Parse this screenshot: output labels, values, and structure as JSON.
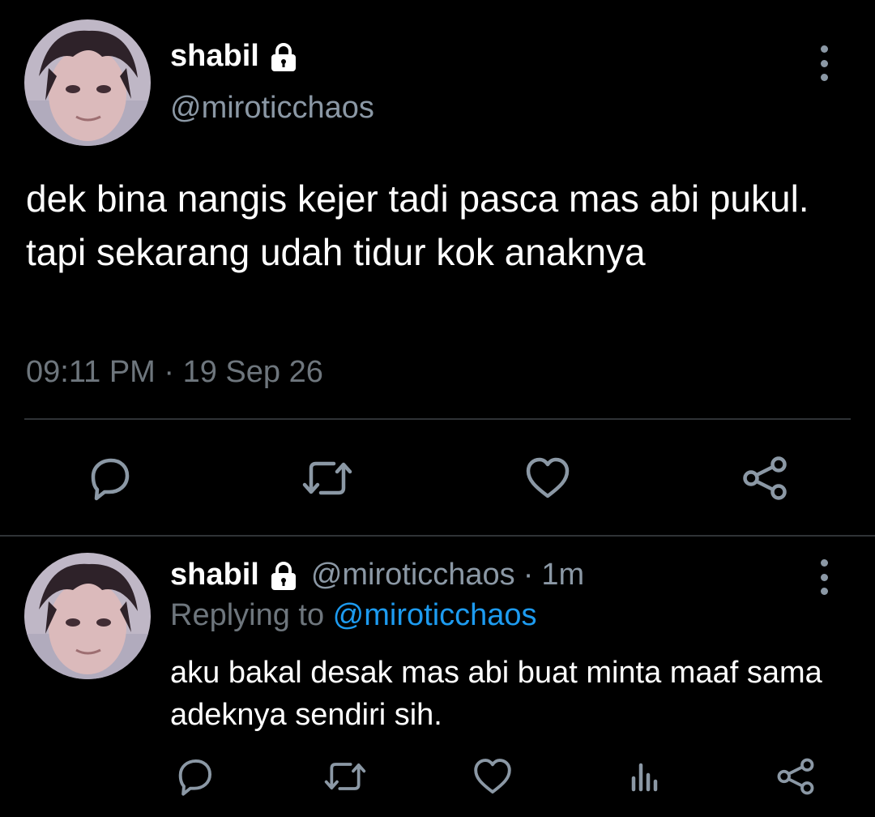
{
  "main_tweet": {
    "display_name": "shabil",
    "handle": "@miroticchaos",
    "text": "dek bina nangis kejer tadi pasca mas abi pukul. tapi sekarang udah tidur kok anaknya",
    "timestamp": "09:11 PM · 19 Sep 26",
    "actions": [
      "reply-icon",
      "retweet-icon",
      "like-icon",
      "share-icon"
    ]
  },
  "reply_tweet": {
    "display_name": "shabil",
    "handle": "@miroticchaos",
    "separator": "·",
    "time_ago": "1m",
    "replying_prefix": "Replying to ",
    "replying_to": "@miroticchaos",
    "text": "aku bakal desak mas abi buat minta maaf sama adeknya sendiri sih.",
    "actions": [
      "reply-icon",
      "retweet-icon",
      "like-icon",
      "analytics-icon",
      "share-icon"
    ]
  },
  "colors": {
    "background": "#000000",
    "primary_text": "#ffffff",
    "secondary_text": "#8b98a5",
    "mention": "#1d9bf0",
    "divider": "#2f3336"
  }
}
